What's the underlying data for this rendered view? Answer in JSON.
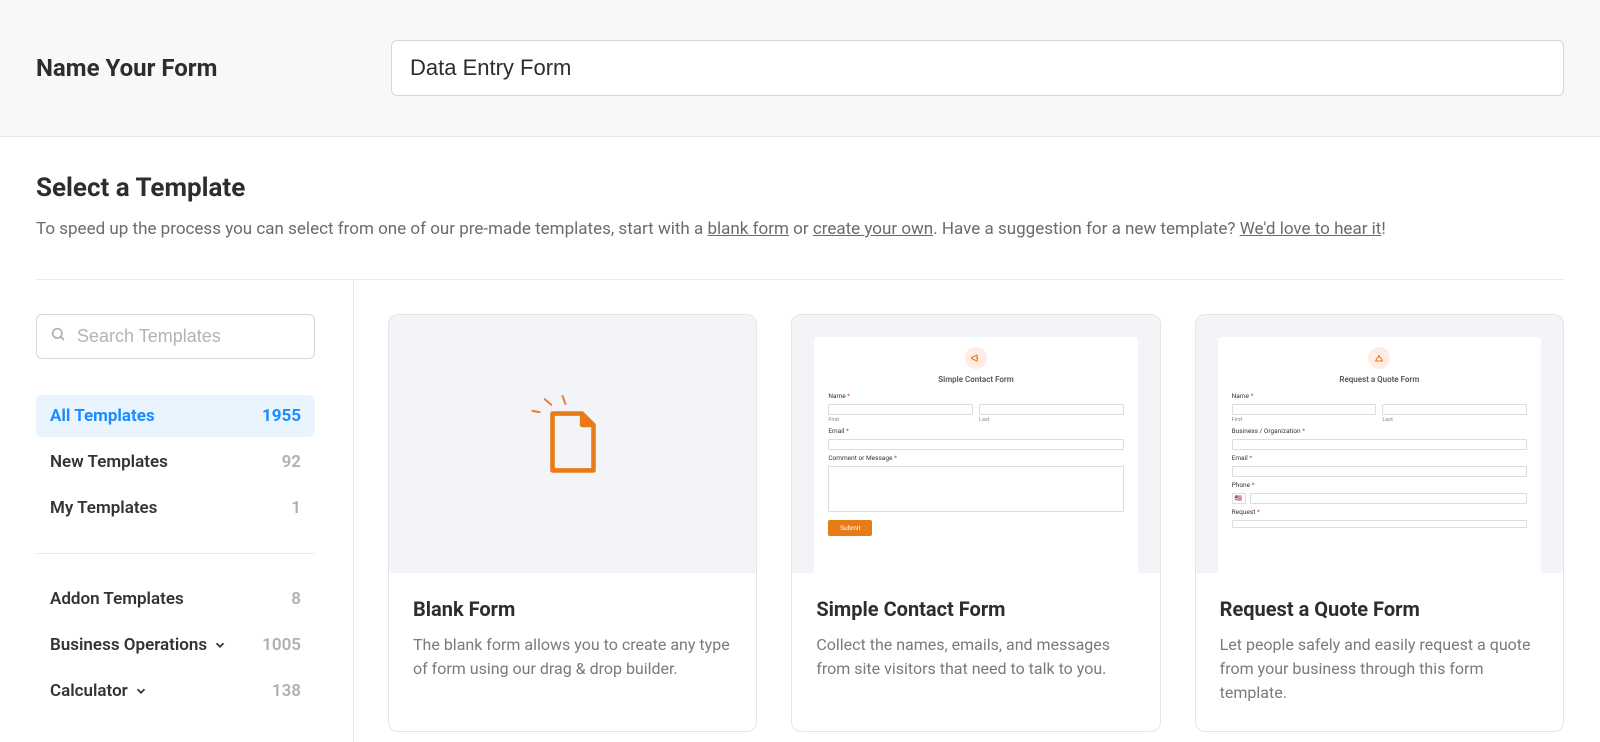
{
  "header": {
    "label": "Name Your Form",
    "form_name_value": "Data Entry Form"
  },
  "select_template": {
    "heading": "Select a Template",
    "text_pre": "To speed up the process you can select from one of our pre-made templates, start with a ",
    "link_blank": "blank form",
    "text_or": " or ",
    "link_create": "create your own",
    "text_suggest": ". Have a suggestion for a new template? ",
    "link_hear": "We'd love to hear it",
    "text_end": "!"
  },
  "sidebar": {
    "search_placeholder": "Search Templates",
    "groups": {
      "primary": [
        {
          "label": "All Templates",
          "count": "1955",
          "active": true
        },
        {
          "label": "New Templates",
          "count": "92",
          "active": false
        },
        {
          "label": "My Templates",
          "count": "1",
          "active": false
        }
      ],
      "secondary": [
        {
          "label": "Addon Templates",
          "count": "8",
          "expandable": false
        },
        {
          "label": "Business Operations",
          "count": "1005",
          "expandable": true
        },
        {
          "label": "Calculator",
          "count": "138",
          "expandable": true
        }
      ]
    }
  },
  "templates": [
    {
      "title": "Blank Form",
      "description": "The blank form allows you to create any type of form using our drag & drop builder.",
      "preview": {
        "type": "blank"
      }
    },
    {
      "title": "Simple Contact Form",
      "description": "Collect the names, emails, and messages from site visitors that need to talk to you.",
      "preview": {
        "type": "contact",
        "heading": "Simple Contact Form",
        "name_label": "Name",
        "first_sub": "First",
        "last_sub": "Last",
        "email_label": "Email",
        "message_label": "Comment or Message",
        "submit": "Submit"
      }
    },
    {
      "title": "Request a Quote Form",
      "description": "Let people safely and easily request a quote from your business through this form template.",
      "preview": {
        "type": "quote",
        "heading": "Request a Quote Form",
        "name_label": "Name",
        "first_sub": "First",
        "last_sub": "Last",
        "business_label": "Business / Organization",
        "email_label": "Email",
        "phone_label": "Phone",
        "request_label": "Request"
      }
    }
  ]
}
